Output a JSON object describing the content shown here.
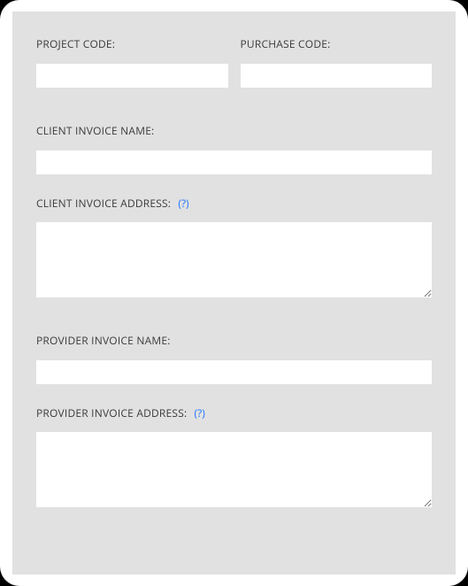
{
  "codes": {
    "project_label": "PROJECT CODE:",
    "project_value": "",
    "purchase_label": "PURCHASE CODE:",
    "purchase_value": ""
  },
  "client": {
    "name_label": "CLIENT INVOICE NAME:",
    "name_value": "",
    "address_label": "CLIENT INVOICE ADDRESS:",
    "address_hint": "(?)",
    "address_value": ""
  },
  "provider": {
    "name_label": "PROVIDER INVOICE NAME:",
    "name_value": "",
    "address_label": "PROVIDER INVOICE ADDRESS:",
    "address_hint": "(?)",
    "address_value": ""
  }
}
